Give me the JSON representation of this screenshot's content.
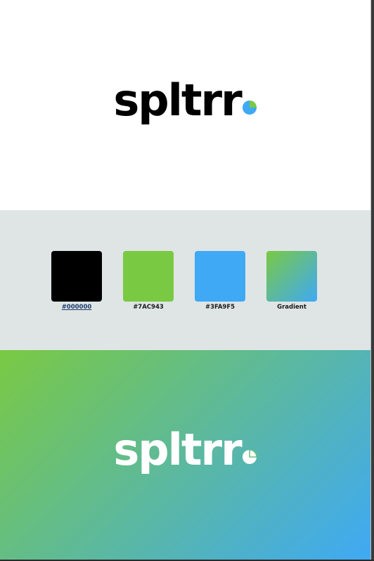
{
  "brand": {
    "name": "spltrr",
    "colors": {
      "black": "#000000",
      "green": "#7AC943",
      "blue": "#3FA9F5",
      "palette_bg": "#DFE5E5"
    },
    "mark_icon": "pie-chart-icon"
  },
  "palette": {
    "swatches": [
      {
        "label": "#000000",
        "color": "#000000"
      },
      {
        "label": "#7AC943",
        "color": "#7AC943"
      },
      {
        "label": "#3FA9F5",
        "color": "#3FA9F5"
      },
      {
        "label": "Gradient",
        "color": "gradient"
      }
    ]
  },
  "gradient_banner": {
    "start": "#7AC943",
    "end": "#3FA9F5"
  }
}
